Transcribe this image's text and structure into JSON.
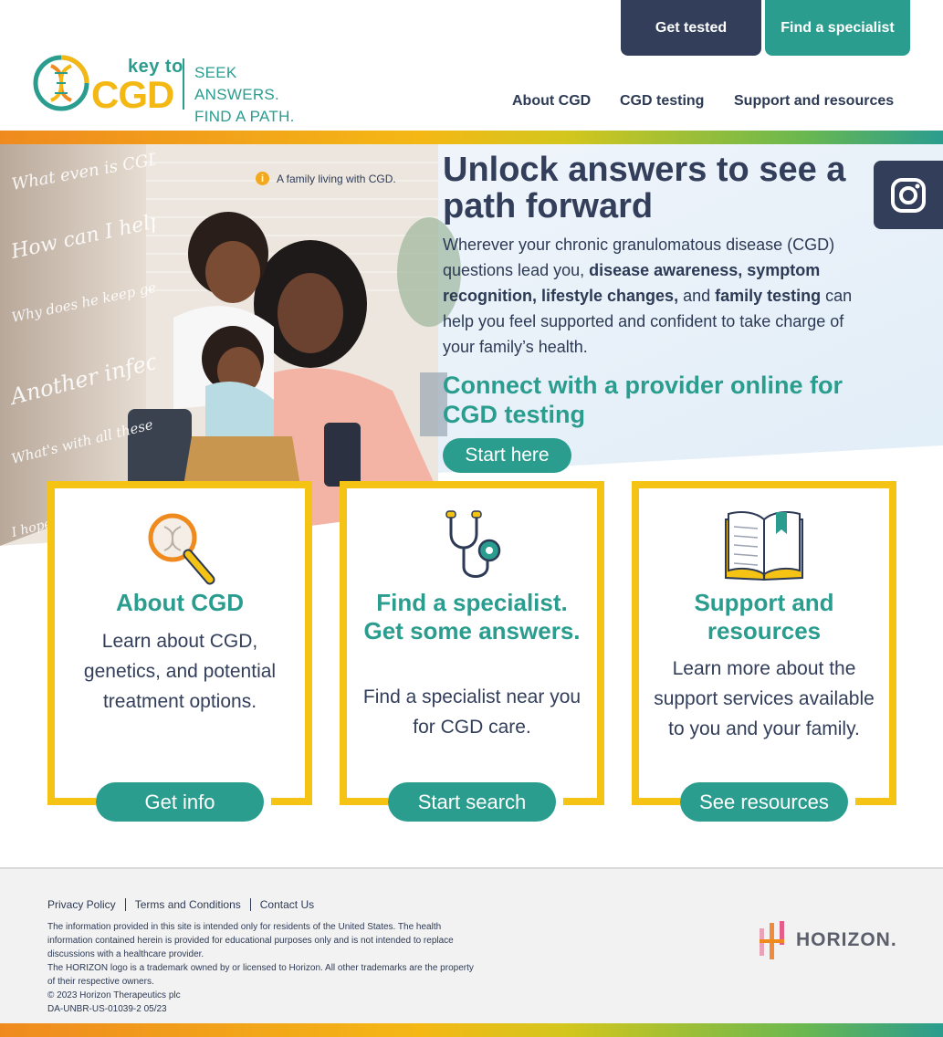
{
  "header": {
    "logo": {
      "key_to": "key to",
      "cgd": "CGD",
      "tagline_1": "SEEK ANSWERS.",
      "tagline_2": "FIND A PATH."
    },
    "get_tested": "Get tested",
    "find_specialist": "Find a specialist",
    "nav": [
      "About CGD",
      "CGD testing",
      "Support and resources"
    ]
  },
  "hero": {
    "photo_caption": "A family living with CGD.",
    "info_glyph": "i",
    "title": "Unlock answers to see a path forward",
    "body_1": "Wherever your chronic granulomatous disease (CGD) questions lead you, ",
    "body_bold_1": "disease awareness, symptom recognition, lifestyle changes,",
    "body_2": " and ",
    "body_bold_2": "family testing",
    "body_3": " can help you feel supported and confident to take charge of your family’s health.",
    "subtitle": "Connect with a provider online for CGD testing",
    "start_button": "Start here",
    "wall_text": [
      "What even is CGD?",
      "How can I help him?",
      "Why does he keep getting sick?",
      "Another infection?",
      "What's with all these doctors?",
      "I hope we don't end up in the ER"
    ]
  },
  "cards": [
    {
      "title": "About CGD",
      "text": "Learn about CGD, genetics, and potential treatment options.",
      "button": "Get info",
      "icon": "magnifier-dna-icon"
    },
    {
      "title": "Find a specialist. Get some answers.",
      "text": "Find a specialist near you for CGD care.",
      "button": "Start search",
      "icon": "stethoscope-icon"
    },
    {
      "title": "Support and resources",
      "text": "Learn more about the support services available to you and your family.",
      "button": "See resources",
      "icon": "open-book-icon"
    }
  ],
  "footer": {
    "links": [
      "Privacy Policy",
      "Terms and Conditions",
      "Contact Us"
    ],
    "disclaimer_1": "The information provided in this site is intended only for residents of the United States. The health information contained herein is provided for educational purposes only and is not intended to replace discussions with a healthcare provider.",
    "disclaimer_2": "The HORIZON logo is a trademark owned by or licensed to Horizon. All other trademarks are the property of their respective owners.",
    "copyright": "© 2023 Horizon Therapeutics plc",
    "code": "DA-UNBR-US-01039-2 05/23",
    "brand": "HORIZON."
  },
  "colors": {
    "teal": "#2a9d8f",
    "navy": "#323e5a",
    "yellow": "#f5c314",
    "orange": "#ef8a1f"
  }
}
